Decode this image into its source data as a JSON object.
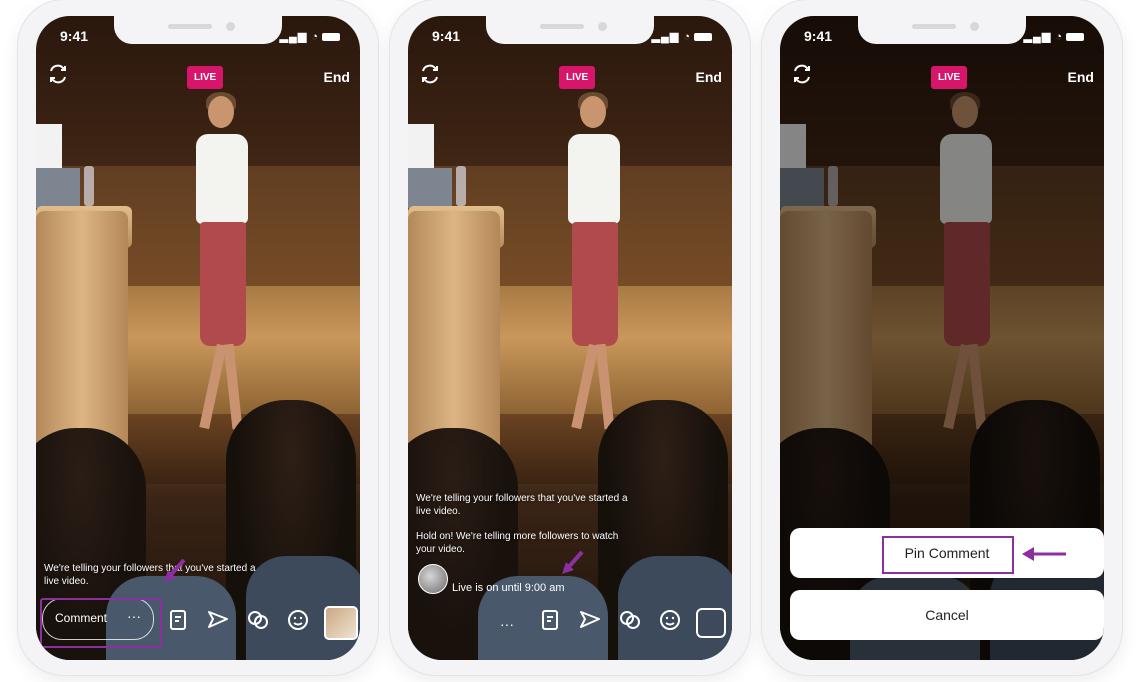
{
  "phones": [
    {
      "status_time": "9:41",
      "live_label": "LIVE",
      "end_label": "End",
      "caption_lines": [
        "We're telling your followers that you've started a",
        "live video."
      ],
      "comment_label": "Comment",
      "comment_more": "···"
    },
    {
      "status_time": "9:41",
      "live_label": "LIVE",
      "end_label": "End",
      "caption_1": [
        "We're telling your followers that you've started a",
        "live video."
      ],
      "caption_2": [
        "Hold on! We're telling more followers to watch",
        "your video."
      ],
      "live_until": "Live is on until 9:00 am",
      "comment_more": "···"
    },
    {
      "status_time": "9:41",
      "live_label": "LIVE",
      "end_label": "End",
      "pin_label": "Pin Comment",
      "cancel_label": "Cancel"
    }
  ],
  "colors": {
    "live_badge": "#d7166b",
    "annotation": "#8c2fa0"
  },
  "icons": [
    "flip-camera-icon",
    "question-box-icon",
    "send-icon",
    "add-guest-icon",
    "face-effects-icon",
    "gallery-thumbnail-icon",
    "arrow-annotation-icon"
  ]
}
